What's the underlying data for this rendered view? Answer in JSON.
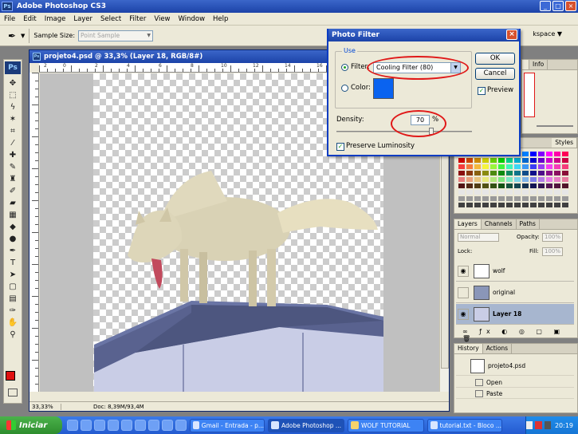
{
  "app": {
    "title": "Adobe Photoshop CS3",
    "logo": "Ps"
  },
  "menu": [
    "File",
    "Edit",
    "Image",
    "Layer",
    "Select",
    "Filter",
    "View",
    "Window",
    "Help"
  ],
  "options": {
    "sample_size_label": "Sample Size:",
    "sample_size_value": "Point Sample",
    "workspace": "kspace ▼"
  },
  "document": {
    "title": "projeto4.psd @ 33,3% (Layer 18, RGB/8#)",
    "zoom": "33,33%",
    "doc_info": "Doc: 8,39M/93,4M",
    "ruler_numbers": [
      "2",
      "0",
      "2",
      "4",
      "6",
      "8",
      "10",
      "12",
      "14",
      "16",
      "18",
      "20",
      "22"
    ]
  },
  "dialog": {
    "title": "Photo Filter",
    "use_label": "Use",
    "filter_label": "Filter:",
    "filter_value": "Cooling Filter (80)",
    "color_label": "Color:",
    "color_hex": "#0a63f0",
    "density_label": "Density:",
    "density_value": 70,
    "density_unit": "%",
    "preserve_label": "Preserve Luminosity",
    "preserve_checked": true,
    "preview_label": "Preview",
    "preview_checked": true,
    "ok_label": "OK",
    "cancel_label": "Cancel"
  },
  "panels": {
    "navigator_tabs": [
      "",
      "Info"
    ],
    "swatch_tabs": [
      "Styles"
    ],
    "layer_tabs": [
      "Layers",
      "Channels",
      "Paths"
    ],
    "blend_mode": "Normal",
    "opacity_label": "Opacity:",
    "opacity_value": "100%",
    "lock_label": "Lock:",
    "fill_label": "Fill:",
    "fill_value": "100%",
    "layers": [
      {
        "name": "wolf",
        "visible": true,
        "selected": false
      },
      {
        "name": "original",
        "visible": false,
        "selected": false
      },
      {
        "name": "Layer 18",
        "visible": true,
        "selected": true
      }
    ],
    "history_tabs": [
      "History",
      "Actions"
    ],
    "history_snapshot": "projeto4.psd",
    "history_items": [
      "Open",
      "Paste"
    ]
  },
  "taskbar": {
    "start_label": "Iniciar",
    "buttons": [
      "Gmail - Entrada - p...",
      "Adobe Photoshop ...",
      "WOLF TUTORIAL",
      "tutorial.txt - Bloco ..."
    ],
    "active_index": 1,
    "clock": "20:19"
  }
}
